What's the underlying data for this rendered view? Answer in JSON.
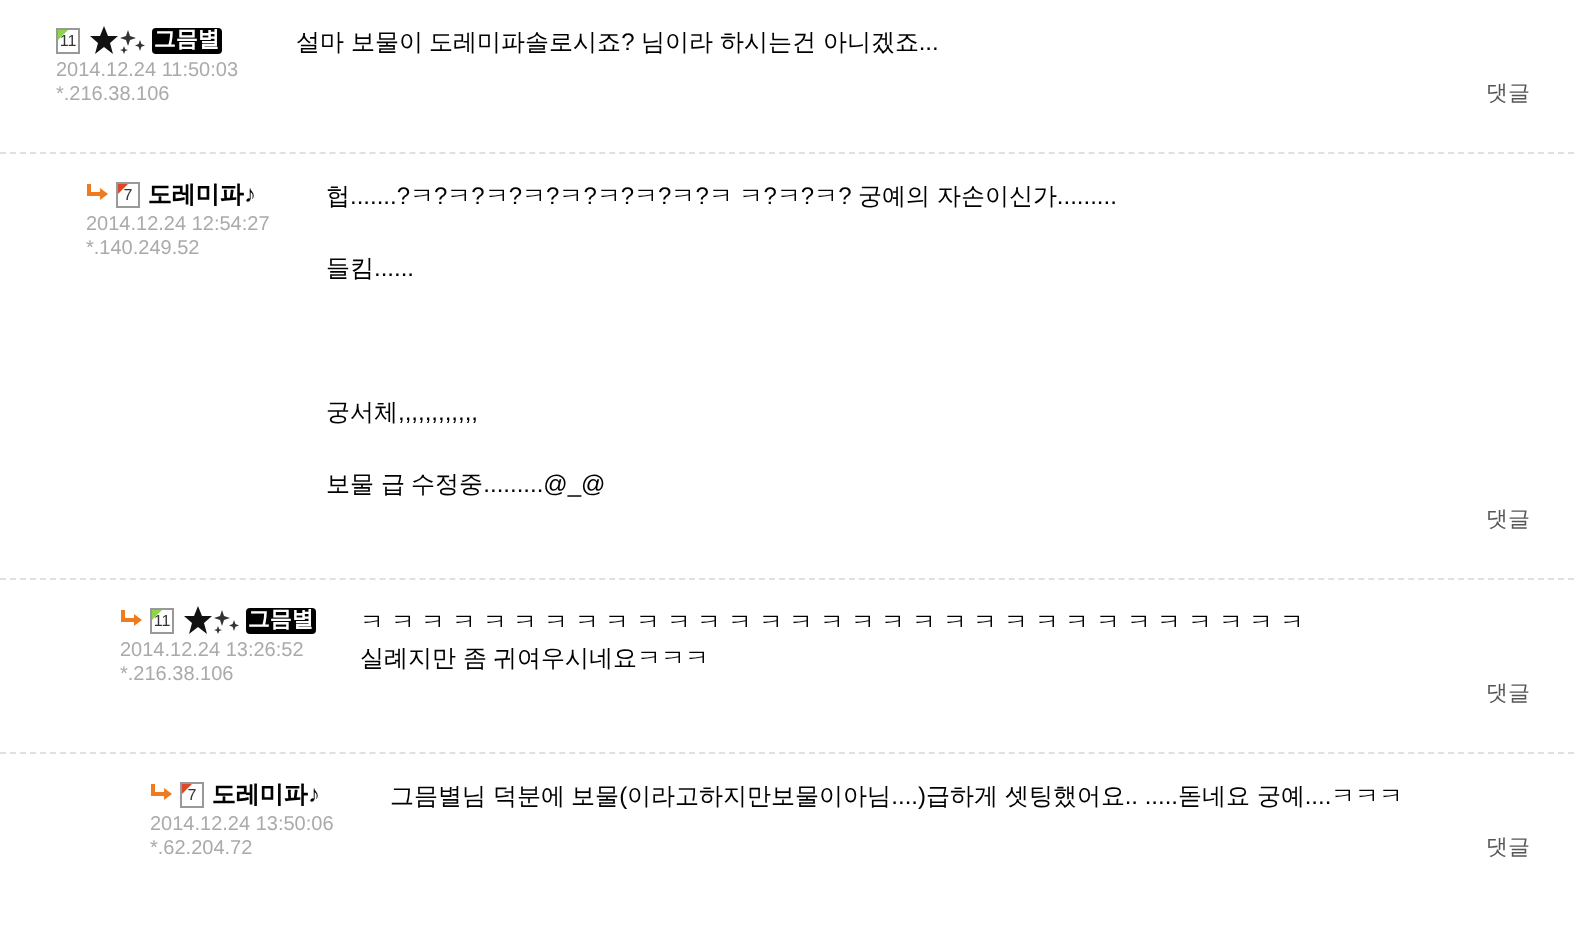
{
  "comments": [
    {
      "level": "11",
      "color": "#8cd44a",
      "nick": "그믐별",
      "kind": "starred",
      "date": "2014.12.24 11:50:03",
      "ip": "*.216.38.106",
      "lines": [
        {
          "text": "설마 보물이 도레미파솔로시죠? 님이라 하시는건 아니겠죠..."
        }
      ],
      "reply": "댓글",
      "children": [
        {
          "level": "7",
          "color": "#d9492a",
          "nick": "도레미파♪",
          "kind": "plain",
          "date": "2014.12.24 12:54:27",
          "ip": "*.140.249.52",
          "lines": [
            {
              "text": "헙.......?ㅋ?ㅋ?ㅋ?ㅋ?ㅋ?ㅋ?ㅋ?ㅋ?ㅋ ㅋ?ㅋ?ㅋ? 궁예의 자손이신가.........",
              "kind": "para"
            },
            {
              "text": "들킴......",
              "kind": "section"
            },
            {
              "text": "궁서체,,,,,,,,,,,,",
              "kind": "para"
            },
            {
              "text": "보물 급 수정중.........@_@"
            }
          ],
          "reply": "댓글",
          "children": [
            {
              "level": "11",
              "color": "#8cd44a",
              "nick": "그믐별",
              "kind": "starred",
              "date": "2014.12.24 13:26:52",
              "ip": "*.216.38.106",
              "lines": [
                {
                  "text": "ㅋ ㅋ ㅋ ㅋ ㅋ ㅋ ㅋ ㅋ ㅋ ㅋ ㅋ ㅋ ㅋ ㅋ ㅋ ㅋ ㅋ ㅋ ㅋ ㅋ ㅋ ㅋ ㅋ ㅋ ㅋ ㅋ ㅋ ㅋ ㅋ ㅋ ㅋ"
                },
                {
                  "text": "실례지만 좀 귀여우시네요ㅋㅋㅋ"
                }
              ],
              "reply": "댓글",
              "children": [
                {
                  "level": "7",
                  "color": "#d9492a",
                  "nick": "도레미파♪",
                  "kind": "plain",
                  "date": "2014.12.24 13:50:06",
                  "ip": "*.62.204.72",
                  "lines": [
                    {
                      "text": "그믐별님 덕분에 보물(이라고하지만보물이아님....)급하게 셋팅했어요.. .....돋네요 궁예....ㅋㅋㅋ"
                    }
                  ],
                  "reply": "댓글"
                }
              ]
            }
          ]
        }
      ]
    }
  ]
}
